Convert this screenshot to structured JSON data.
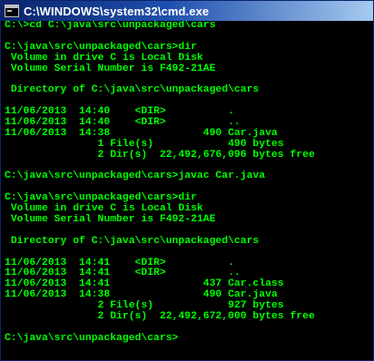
{
  "window": {
    "title": "C:\\WINDOWS\\system32\\cmd.exe",
    "text_color": "#00ff00",
    "background": "#000000"
  },
  "console": {
    "lines": [
      "C:\\>cd C:\\java\\src\\unpackaged\\cars",
      "",
      "C:\\java\\src\\unpackaged\\cars>dir",
      " Volume in drive C is Local Disk",
      " Volume Serial Number is F492-21AE",
      "",
      " Directory of C:\\java\\src\\unpackaged\\cars",
      "",
      "11/06/2013  14:40    <DIR>          .",
      "11/06/2013  14:40    <DIR>          ..",
      "11/06/2013  14:38               490 Car.java",
      "               1 File(s)            490 bytes",
      "               2 Dir(s)  22,492,676,096 bytes free",
      "",
      "C:\\java\\src\\unpackaged\\cars>javac Car.java",
      "",
      "C:\\java\\src\\unpackaged\\cars>dir",
      " Volume in drive C is Local Disk",
      " Volume Serial Number is F492-21AE",
      "",
      " Directory of C:\\java\\src\\unpackaged\\cars",
      "",
      "11/06/2013  14:41    <DIR>          .",
      "11/06/2013  14:41    <DIR>          ..",
      "11/06/2013  14:41               437 Car.class",
      "11/06/2013  14:38               490 Car.java",
      "               2 File(s)            927 bytes",
      "               2 Dir(s)  22,492,672,000 bytes free",
      "",
      "C:\\java\\src\\unpackaged\\cars>"
    ]
  }
}
